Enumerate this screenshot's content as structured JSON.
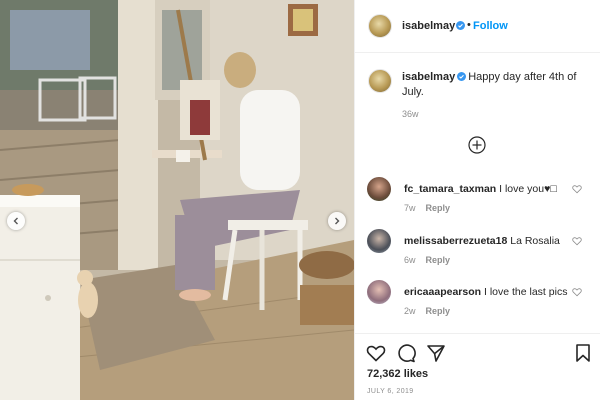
{
  "post": {
    "username": "isabelmay",
    "follow_label": "Follow",
    "separator": "•",
    "caption": "Happy day after 4th of July.",
    "caption_age": "36w",
    "likes": "72,362 likes",
    "date": "JULY 6, 2019"
  },
  "comments": [
    {
      "username": "fc_tamara_taxman",
      "text": "I love you♥□",
      "age": "7w",
      "reply": "Reply"
    },
    {
      "username": "melissaberrezueta18",
      "text": "La Rosalia",
      "age": "6w",
      "reply": "Reply"
    },
    {
      "username": "ericaaapearson",
      "text": "I love the last pics",
      "age": "2w",
      "reply": "Reply"
    }
  ],
  "icons": {
    "verified": "verified-badge-icon",
    "load_more": "plus-circle-icon",
    "like": "heart-icon",
    "comment": "comment-bubble-icon",
    "share": "paper-plane-icon",
    "save": "bookmark-icon",
    "prev": "chevron-left-icon",
    "next": "chevron-right-icon"
  },
  "colors": {
    "accent": "#0095f6",
    "text": "#262626",
    "muted": "#8e8e8e",
    "border": "#efefef"
  }
}
